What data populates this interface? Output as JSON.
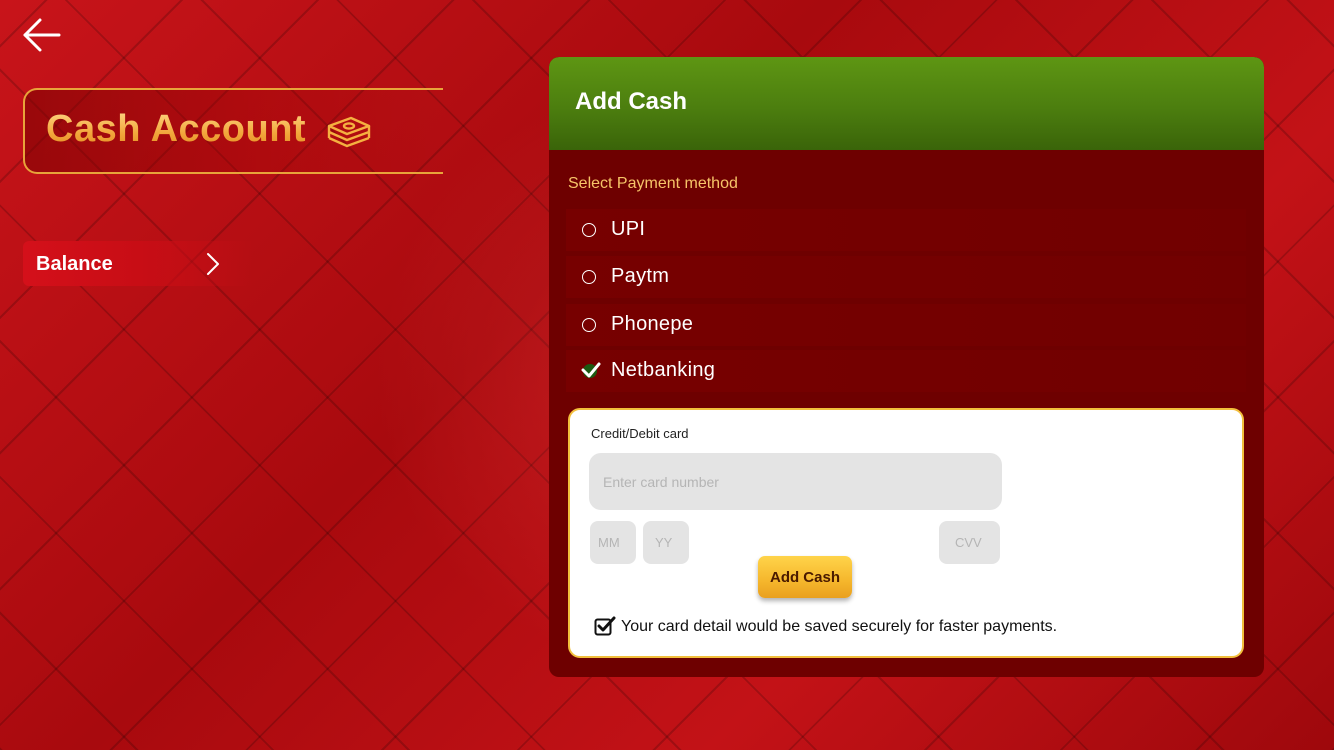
{
  "header": {
    "back_icon": "arrow-left-icon"
  },
  "left": {
    "title": "Cash Account",
    "title_icon": "money-stack-icon",
    "nav": [
      {
        "label": "Balance",
        "icon": "chevron-right-icon"
      }
    ]
  },
  "panel": {
    "title": "Add Cash",
    "select_label": "Select Payment method",
    "options": [
      {
        "label": "UPI",
        "selected": false
      },
      {
        "label": "Paytm",
        "selected": false
      },
      {
        "label": "Phonepe",
        "selected": false
      },
      {
        "label": "Netbanking",
        "selected": true
      }
    ],
    "card": {
      "label": "Credit/Debit card",
      "card_number_placeholder": "Enter card number",
      "mm_placeholder": "MM",
      "yy_placeholder": "YY",
      "cvv_placeholder": "CVV",
      "submit_label": "Add Cash",
      "save_notice": "Your card detail would be saved securely for faster payments.",
      "save_checked": true
    }
  },
  "colors": {
    "accent_gold": "#f6b54a",
    "header_green": "#4c7e0f",
    "panel_dark_red": "#6e0000",
    "button_gold": "#f5b62c"
  }
}
